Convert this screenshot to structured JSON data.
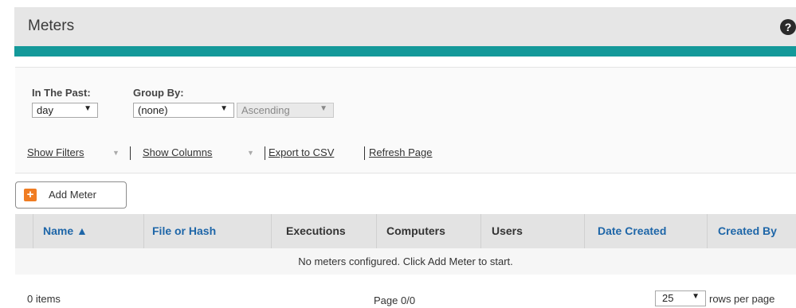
{
  "header": {
    "title": "Meters",
    "help_icon": "question-circle-icon"
  },
  "accent_colors": {
    "teal": "#14999a",
    "orange": "#f07c22",
    "link_blue": "#1e66a8"
  },
  "controls": {
    "in_the_past_label": "In The Past:",
    "in_the_past_value": "day",
    "group_by_label": "Group By:",
    "group_by_value": "(none)",
    "order_value": "Ascending"
  },
  "links": {
    "show_filters": "Show Filters",
    "show_columns": "Show Columns",
    "export_csv": "Export to CSV",
    "refresh": "Refresh Page"
  },
  "add_button": {
    "label": "Add Meter",
    "icon": "plus-icon"
  },
  "table": {
    "columns": [
      {
        "label": "Name ▲",
        "sortable": true
      },
      {
        "label": "File or Hash",
        "sortable": true
      },
      {
        "label": "Executions",
        "sortable": false
      },
      {
        "label": "Computers",
        "sortable": false
      },
      {
        "label": "Users",
        "sortable": false
      },
      {
        "label": "Date Created",
        "sortable": true
      },
      {
        "label": "Created By",
        "sortable": true
      }
    ],
    "empty_message": "No meters configured. Click Add Meter to start."
  },
  "footer": {
    "items": "0  items",
    "page": "Page 0/0",
    "rows_per_page": "25",
    "rows_per_page_label": "rows per page"
  }
}
